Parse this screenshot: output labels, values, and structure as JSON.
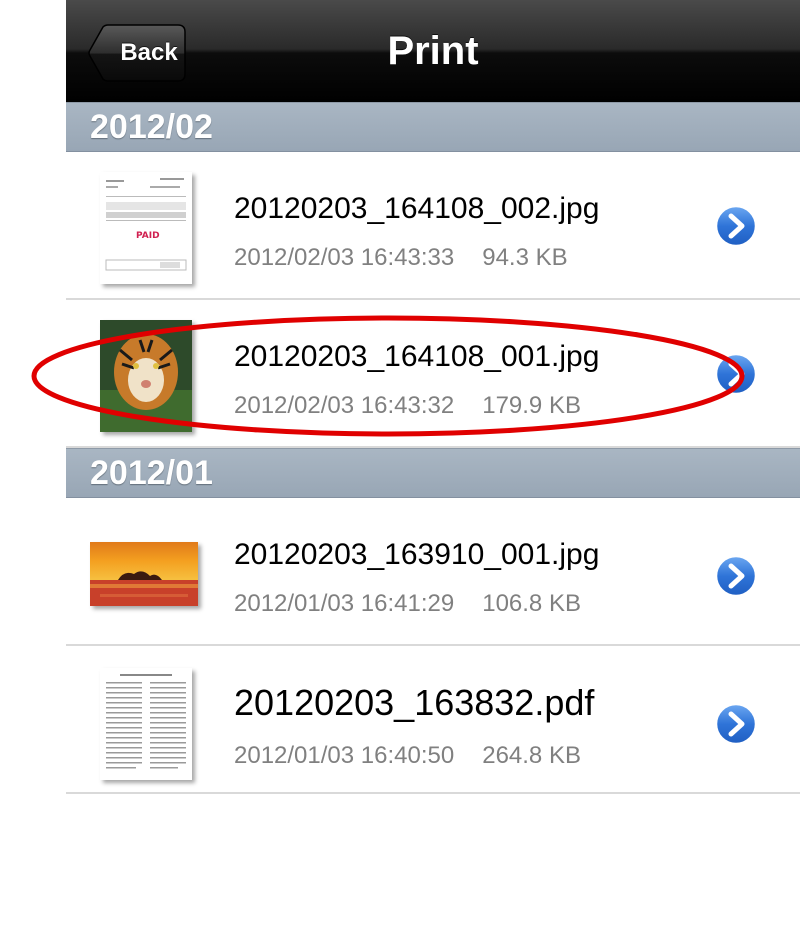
{
  "navbar": {
    "back_label": "Back",
    "title": "Print"
  },
  "sections": [
    {
      "header": "2012/02",
      "items": [
        {
          "name": "20120203_164108_002.jpg",
          "date": "2012/02/03 16:43:33",
          "size": "94.3 KB",
          "thumbnail": "document-scan-thumbnail"
        },
        {
          "name": "20120203_164108_001.jpg",
          "date": "2012/02/03 16:43:32",
          "size": "179.9 KB",
          "thumbnail": "tiger-photo-thumbnail"
        }
      ]
    },
    {
      "header": "2012/01",
      "items": [
        {
          "name": "20120203_163910_001.jpg",
          "date": "2012/01/03 16:41:29",
          "size": "106.8 KB",
          "thumbnail": "sunset-photo-thumbnail"
        },
        {
          "name": "20120203_163832.pdf",
          "date": "2012/01/03 16:40:50",
          "size": "264.8 KB",
          "thumbnail": "pdf-page-thumbnail"
        }
      ]
    }
  ],
  "colors": {
    "navbar": "#000000",
    "section_header": "#9eabb9",
    "disclosure": "#2a70d6",
    "highlight": "#e00000"
  },
  "icons": {
    "disclosure": "chevron-right-circle-icon"
  }
}
